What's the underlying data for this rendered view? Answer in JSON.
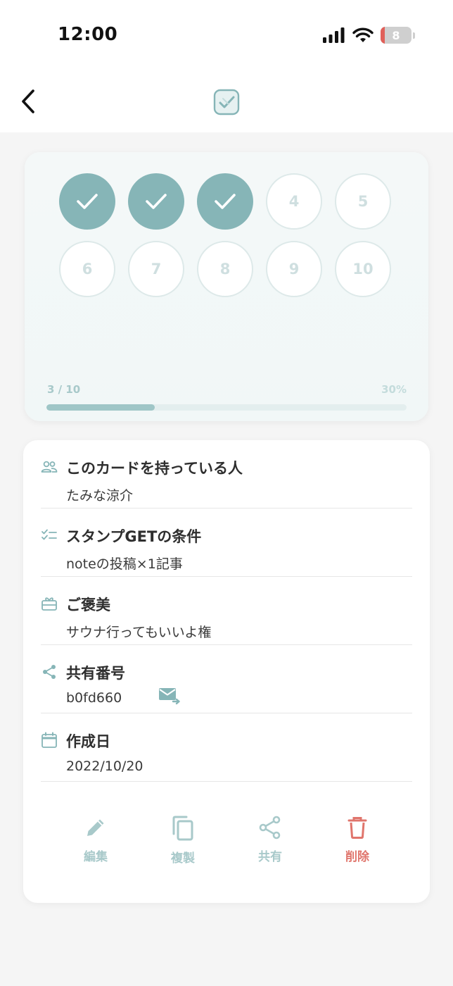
{
  "status_bar": {
    "time": "12:00",
    "battery_level": "8",
    "battery_fraction": 0.08
  },
  "header": {
    "back_icon": "chevron-left-icon",
    "logo_icon": "stamp-check-logo-icon"
  },
  "stamp_card": {
    "stamps": [
      {
        "label": "",
        "done": true
      },
      {
        "label": "",
        "done": true
      },
      {
        "label": "",
        "done": true
      },
      {
        "label": "4",
        "done": false
      },
      {
        "label": "5",
        "done": false
      },
      {
        "label": "6",
        "done": false
      },
      {
        "label": "7",
        "done": false
      },
      {
        "label": "8",
        "done": false
      },
      {
        "label": "9",
        "done": false
      },
      {
        "label": "10",
        "done": false
      }
    ],
    "progress_text": "3 / 10",
    "progress_percent": "30%",
    "progress_value": 0.3
  },
  "info": {
    "owner": {
      "title": "このカードを持っている人",
      "value": "たみな涼介",
      "icon": "people-icon"
    },
    "condition": {
      "title": "スタンプGETの条件",
      "value": "noteの投稿×1記事",
      "icon": "checklist-icon"
    },
    "reward": {
      "title": "ご褒美",
      "value": "サウナ行ってもいいよ権",
      "icon": "gift-icon"
    },
    "share_code": {
      "title": "共有番号",
      "value": "b0fd660",
      "icon": "share-icon",
      "send_icon": "mail-send-icon"
    },
    "created": {
      "title": "作成日",
      "value": "2022/10/20",
      "icon": "calendar-icon"
    }
  },
  "actions": {
    "edit": {
      "label": "編集",
      "icon": "pencil-icon"
    },
    "duplicate": {
      "label": "複製",
      "icon": "copy-icon"
    },
    "share": {
      "label": "共有",
      "icon": "share-icon"
    },
    "delete": {
      "label": "削除",
      "icon": "trash-icon"
    }
  },
  "colors": {
    "accent": "#86b5b7",
    "accent_light": "#a8c9ca",
    "danger": "#e0756c",
    "background": "#f5f5f5",
    "card": "#ffffff"
  }
}
